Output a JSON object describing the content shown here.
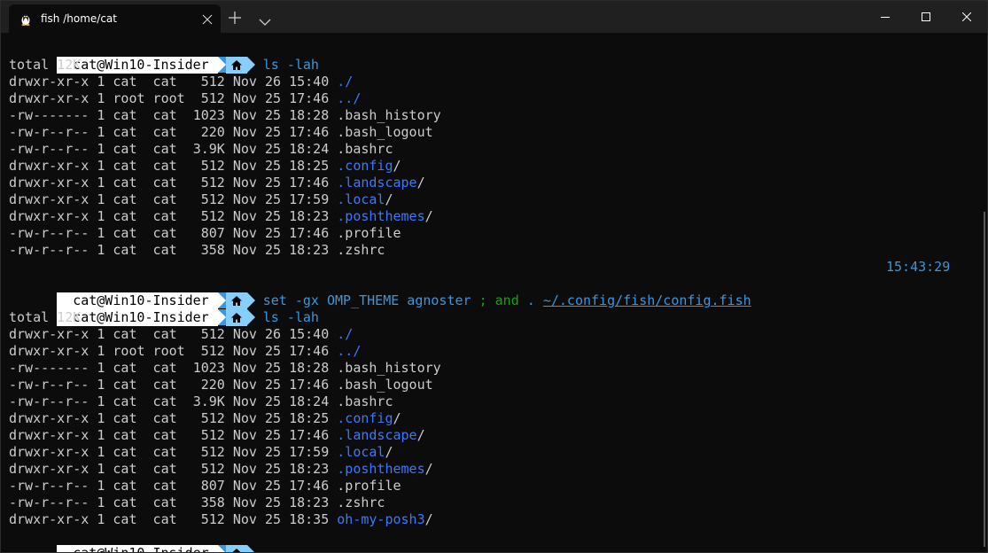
{
  "tab": {
    "title": "fish /home/cat",
    "icon": "linux-penguin-icon"
  },
  "prompt": {
    "user": "cat@Win10-Insider",
    "home_icon": "home-icon"
  },
  "blocks": [
    {
      "command": "ls -lah",
      "total": "total 12K",
      "rows": [
        {
          "meta": "drwxr-xr-x 1 cat  cat   512 Nov 26 15:40 ",
          "name": "./",
          "suffix": ""
        },
        {
          "meta": "drwxr-xr-x 1 root root  512 Nov 25 17:46 ",
          "name": "../",
          "suffix": ""
        },
        {
          "meta": "-rw------- 1 cat  cat  1023 Nov 25 18:28 ",
          "name": ".bash_history",
          "suffix": ""
        },
        {
          "meta": "-rw-r--r-- 1 cat  cat   220 Nov 25 17:46 ",
          "name": ".bash_logout",
          "suffix": ""
        },
        {
          "meta": "-rw-r--r-- 1 cat  cat  3.9K Nov 25 18:24 ",
          "name": ".bashrc",
          "suffix": ""
        },
        {
          "meta": "drwxr-xr-x 1 cat  cat   512 Nov 25 18:25 ",
          "name": ".config",
          "suffix": "/"
        },
        {
          "meta": "drwxr-xr-x 1 cat  cat   512 Nov 25 17:46 ",
          "name": ".landscape",
          "suffix": "/"
        },
        {
          "meta": "drwxr-xr-x 1 cat  cat   512 Nov 25 17:59 ",
          "name": ".local",
          "suffix": "/"
        },
        {
          "meta": "drwxr-xr-x 1 cat  cat   512 Nov 25 18:23 ",
          "name": ".poshthemes",
          "suffix": "/"
        },
        {
          "meta": "-rw-r--r-- 1 cat  cat   807 Nov 25 17:46 ",
          "name": ".profile",
          "suffix": ""
        },
        {
          "meta": "-rw-r--r-- 1 cat  cat   358 Nov 25 18:23 ",
          "name": ".zshrc",
          "suffix": ""
        }
      ]
    },
    {
      "timestamp": "15:43:29",
      "set_cmd": {
        "set": "set -gx OMP_THEME agnoster",
        "semi": ";",
        "and": "and",
        "dot": ".",
        "path": "~/.config/fish/config.fish"
      },
      "command": "ls -lah",
      "total": "total 12K",
      "rows": [
        {
          "meta": "drwxr-xr-x 1 cat  cat   512 Nov 26 15:40 ",
          "name": "./",
          "suffix": ""
        },
        {
          "meta": "drwxr-xr-x 1 root root  512 Nov 25 17:46 ",
          "name": "../",
          "suffix": ""
        },
        {
          "meta": "-rw------- 1 cat  cat  1023 Nov 25 18:28 ",
          "name": ".bash_history",
          "suffix": ""
        },
        {
          "meta": "-rw-r--r-- 1 cat  cat   220 Nov 25 17:46 ",
          "name": ".bash_logout",
          "suffix": ""
        },
        {
          "meta": "-rw-r--r-- 1 cat  cat  3.9K Nov 25 18:24 ",
          "name": ".bashrc",
          "suffix": ""
        },
        {
          "meta": "drwxr-xr-x 1 cat  cat   512 Nov 25 18:25 ",
          "name": ".config",
          "suffix": "/"
        },
        {
          "meta": "drwxr-xr-x 1 cat  cat   512 Nov 25 17:46 ",
          "name": ".landscape",
          "suffix": "/"
        },
        {
          "meta": "drwxr-xr-x 1 cat  cat   512 Nov 25 17:59 ",
          "name": ".local",
          "suffix": "/"
        },
        {
          "meta": "drwxr-xr-x 1 cat  cat   512 Nov 25 18:23 ",
          "name": ".poshthemes",
          "suffix": "/"
        },
        {
          "meta": "-rw-r--r-- 1 cat  cat   807 Nov 25 17:46 ",
          "name": ".profile",
          "suffix": ""
        },
        {
          "meta": "-rw-r--r-- 1 cat  cat   358 Nov 25 18:23 ",
          "name": ".zshrc",
          "suffix": ""
        },
        {
          "meta": "drwxr-xr-x 1 cat  cat   512 Nov 25 18:35 ",
          "name": "oh-my-posh3",
          "suffix": "/"
        }
      ]
    }
  ],
  "colors": {
    "background": "#0c0c0c",
    "text": "#cccccc",
    "directory": "#3b78ff",
    "command": "#3a96dd",
    "operator": "#13a10e"
  }
}
